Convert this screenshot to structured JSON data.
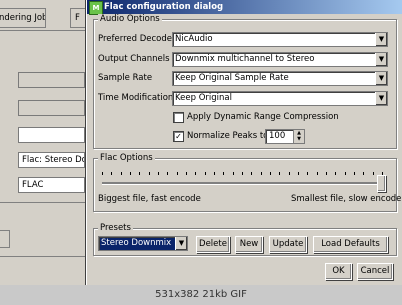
{
  "background": {
    "tab_label": "ndering Job",
    "tab2_label": "F",
    "field3_value": "Flac: Stereo Downmix",
    "field4_value": "FLAC"
  },
  "dialog": {
    "title": "Flac configuration dialog",
    "audio_options": {
      "legend": "Audio Options",
      "preferred_decoder_label": "Preferred Decoder",
      "preferred_decoder_value": "NicAudio",
      "output_channels_label": "Output Channels",
      "output_channels_value": "Downmix multichannel to Stereo",
      "sample_rate_label": "Sample Rate",
      "sample_rate_value": "Keep Original Sample Rate",
      "time_modification_label": "Time Modification",
      "time_modification_value": "Keep Original",
      "drc_label": "Apply Dynamic Range Compression",
      "drc_checked": false,
      "normalize_label": "Normalize Peaks to",
      "normalize_checked": true,
      "normalize_value": "100"
    },
    "flac_options": {
      "legend": "Flac Options",
      "slider_fraction": 1.0,
      "left_caption": "Biggest file, fast encode",
      "right_caption": "Smallest file, slow encode"
    },
    "presets": {
      "legend": "Presets",
      "selected": "Stereo Downmix",
      "delete_label": "Delete",
      "new_label": "New",
      "update_label": "Update",
      "load_defaults_label": "Load Defaults"
    },
    "ok_label": "OK",
    "cancel_label": "Cancel"
  },
  "caption": "531x382 21kb GIF"
}
